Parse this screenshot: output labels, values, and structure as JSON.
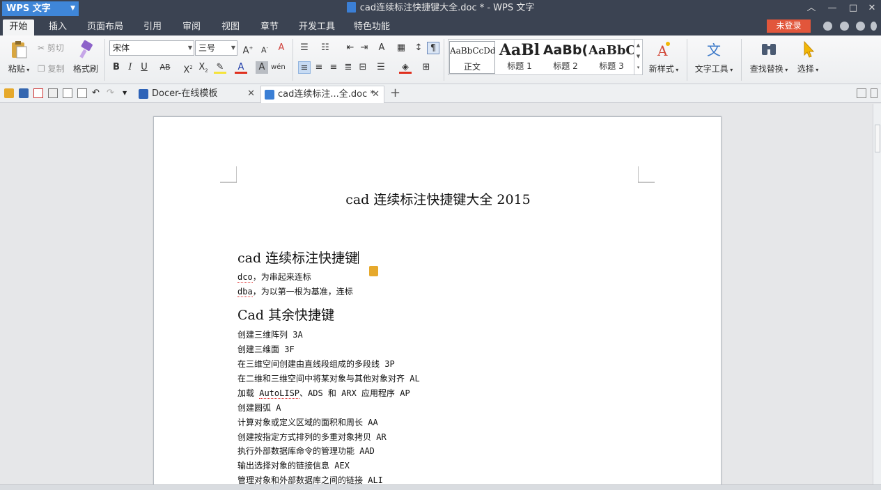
{
  "titlebar": {
    "app_button": "WPS 文字",
    "doc_title": "cad连续标注快捷键大全.doc * - WPS 文字"
  },
  "menu": {
    "tabs": [
      "开始",
      "插入",
      "页面布局",
      "引用",
      "审阅",
      "视图",
      "章节",
      "开发工具",
      "特色功能"
    ],
    "login": "未登录"
  },
  "ribbon": {
    "paste": "粘贴",
    "cut": "剪切",
    "copy": "复制",
    "format_painter": "格式刷",
    "font_name": "宋体",
    "font_size": "三号",
    "styles": [
      {
        "preview": "AaBbCcDd",
        "name": "正文"
      },
      {
        "preview": "AaBl",
        "name": "标题 1"
      },
      {
        "preview": "AaBb(",
        "name": "标题 2"
      },
      {
        "preview": "AaBbC",
        "name": "标题 3"
      }
    ],
    "new_style": "新样式",
    "text_tools": "文字工具",
    "find_replace": "查找替换",
    "select": "选择"
  },
  "doc_tabs": [
    {
      "label": "Docer-在线模板"
    },
    {
      "label": "cad连续标注...全.doc *"
    }
  ],
  "document": {
    "title": "cad 连续标注快捷键大全 2015",
    "heading1": "cad 连续标注快捷键",
    "line_dco_a": "dco",
    "line_dco_b": "，为串起来连标",
    "line_dba_a": "dba",
    "line_dba_b": "，为以第一根为基准，连标",
    "heading2": "Cad 其余快捷键",
    "lines": [
      "创建三维阵列 3A",
      "创建三维面 3F",
      "在三维空间创建由直线段组成的多段线 3P",
      "在二维和三维空间中将某对象与其他对象对齐 AL"
    ],
    "line_autolisp_a": "加载 ",
    "line_autolisp_b": "AutoLISP",
    "line_autolisp_c": "、ADS 和 ARX 应用程序 AP",
    "lines2": [
      "创建圆弧 A",
      "计算对象或定义区域的面积和周长 AA",
      "创建按指定方式排列的多重对象拷贝 AR",
      "执行外部数据库命令的管理功能 AAD",
      "输出选择对象的链接信息 AEX",
      "管理对象和外部数据库之间的链接 ALI"
    ]
  },
  "colors": {
    "titlebar": "#3b4352",
    "accent": "#3f86d8",
    "login": "#e2563b"
  }
}
